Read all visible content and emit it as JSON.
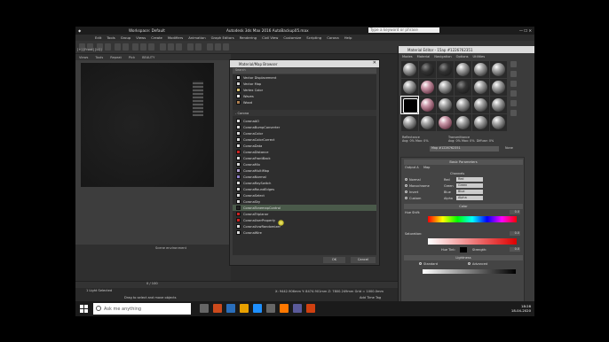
{
  "window": {
    "workspace": "Workspace: Default",
    "title": "Autodesk 3ds Max 2016   AutoBackup05.max",
    "search_placeholder": "Type a keyword or phrase"
  },
  "menubar": [
    "Edit",
    "Tools",
    "Group",
    "Views",
    "Create",
    "Modifiers",
    "Animation",
    "Graph Editors",
    "Rendering",
    "Civil View",
    "Customize",
    "Scripting",
    "Corona",
    "Help"
  ],
  "viewport": {
    "label": "[+] [Front] [LQ]",
    "tabs": [
      "Views",
      "Tools",
      "Repeat",
      "Pick",
      "BEAUTY"
    ]
  },
  "scene_env": "Scene environment",
  "material_browser": {
    "title": "Material/Map Browser",
    "search": "Search",
    "items_top": [
      {
        "label": "Vector Displacement",
        "color": "#d8d8d8"
      },
      {
        "label": "Vector Map",
        "color": "#d8d8d8"
      },
      {
        "label": "Vertex Color",
        "color": "#d8c070"
      },
      {
        "label": "Waves",
        "color": "#e8e8e8"
      },
      {
        "label": "Wood",
        "color": "#b08050"
      }
    ],
    "group": "- Corona",
    "items_corona": [
      {
        "label": "CoronaAO",
        "color": "#dcdcdc"
      },
      {
        "label": "CoronaBumpConverter",
        "color": "#dcdcdc"
      },
      {
        "label": "CoronaColor",
        "color": "#dcdcdc"
      },
      {
        "label": "CoronaColorCorrect",
        "color": "#dcdcdc"
      },
      {
        "label": "CoronaData",
        "color": "#dcdcdc"
      },
      {
        "label": "CoronaDistance",
        "color": "#cc2222"
      },
      {
        "label": "CoronaFrontBack",
        "color": "#dcdcdc"
      },
      {
        "label": "CoronaMix",
        "color": "#dcdcdc"
      },
      {
        "label": "CoronaMultiMap",
        "color": "#b0a0d0"
      },
      {
        "label": "CoronaNormal",
        "color": "#9080d0"
      },
      {
        "label": "CoronaRaySwitch",
        "color": "#dcdcdc"
      },
      {
        "label": "CoronaRoundEdges",
        "color": "#dcdcdc"
      },
      {
        "label": "CoronaSelect",
        "color": "#dcdcdc"
      },
      {
        "label": "CoronaSky",
        "color": "#dcdcdc"
      },
      {
        "label": "CoronaTonemapControl",
        "color": "#222222"
      },
      {
        "label": "CoronaTriplanar",
        "color": "#cc2222"
      },
      {
        "label": "CoronaUserProperty",
        "color": "#cc2222"
      },
      {
        "label": "CoronaUvwRandomizer",
        "color": "#dcdcdc"
      },
      {
        "label": "CoronaWire",
        "color": "#dcdcdc"
      }
    ],
    "ok": "OK",
    "cancel": "Cancel"
  },
  "material_editor": {
    "title": "Material Editor - 15ap #1226762351",
    "menu": [
      "Modes",
      "Material",
      "Navigation",
      "Options",
      "Utilities"
    ],
    "reflectance": "Reflectance\nAvg: 0% Max: 0%",
    "transmittance": "Transmittance\nAvg: 0% Max: 0%  Diffuse: 0%",
    "map_name": "Map #1226762351",
    "map_type": "None",
    "basic_params": "Basic Parameters",
    "output_label": "Output A",
    "output_kind": "Map",
    "channels_header": "Channels",
    "channels": [
      {
        "label": "Normal",
        "value": "Red",
        "prefix": "Red"
      },
      {
        "label": "Monochrome",
        "value": "Green",
        "prefix": "Green"
      },
      {
        "label": "Invert",
        "value": "Blue",
        "prefix": "Blue"
      },
      {
        "label": "Custom",
        "value": "Alpha",
        "prefix": "Alpha"
      }
    ],
    "color_header": "Color",
    "hue_shift": "Hue Shift:",
    "saturation": "Saturation:",
    "hue_tint": "Hue Tint:",
    "strength": "Strength:",
    "lightness_header": "Lightness",
    "standard": "Standard",
    "advanced": "Advanced",
    "brightness": "Brightness:",
    "value_zero": "0.0"
  },
  "timeline": {
    "frame": "0 / 100"
  },
  "status": {
    "selected": "1 Light Selected",
    "hint": "Drag to select and move objects",
    "coords": "X: 9442.906mm  Y: 8474.901mm  Z: 7800.249mm   Grid = 1000.0mm",
    "add_time": "Add Time Tag"
  },
  "taskbar": {
    "search": "Ask me anything",
    "time": "18:28",
    "date": "18-04-2020",
    "icon_colors": [
      "#666666",
      "#cc4a1c",
      "#2a6ebb",
      "#e8a000",
      "#1e90ff",
      "#666666",
      "#ff7800",
      "#5a5a9a",
      "#d04010"
    ]
  }
}
